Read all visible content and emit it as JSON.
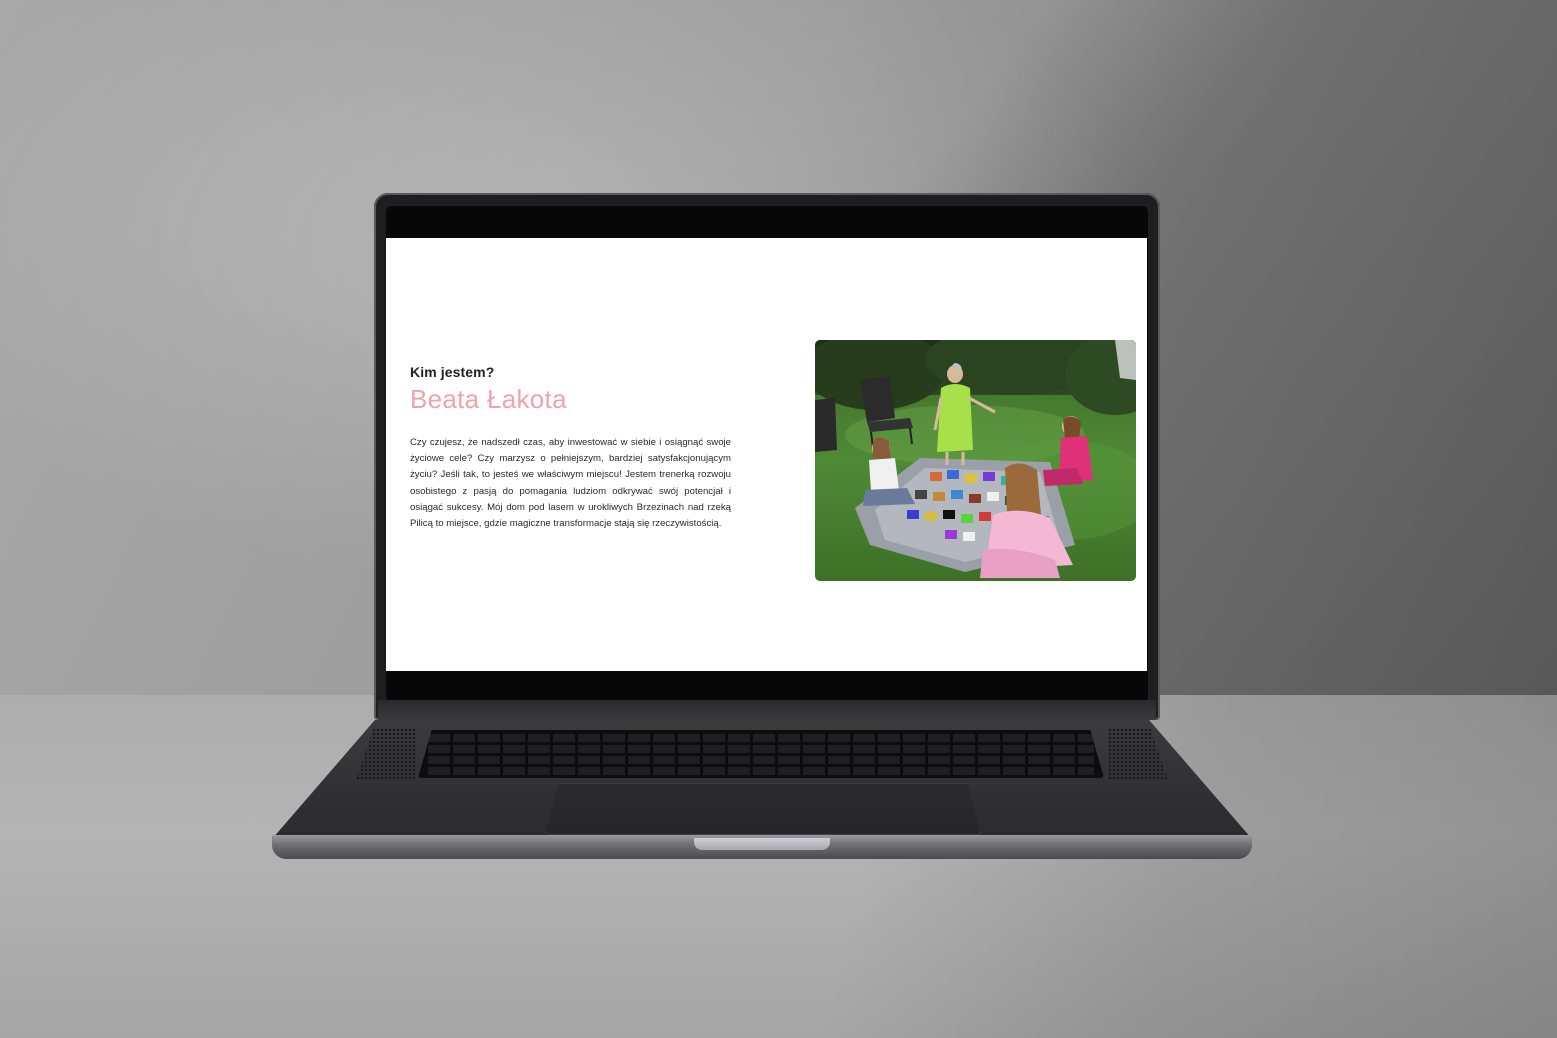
{
  "section": {
    "eyebrow": "Kim jestem?",
    "name": "Beata Łakota",
    "bio": "Czy czujesz, że nadszedł czas, aby inwestować w siebie i osiągnąć swoje życiowe cele? Czy marzysz o pełniejszym, bardziej satysfakcjonującym życiu? Jeśli tak, to jesteś we właściwym miejscu! Jestem trenerką rozwoju osobistego z pasją do pomagania ludziom odkrywać swój potencjał i osiągać sukcesy. Mój dom pod lasem w urokliwych Brzezinach nad rzeką Pilicą to miejsce, gdzie magiczne transformacje stają się rzeczywistością."
  },
  "colors": {
    "accent_pink": "#f0a3ae",
    "text_dark": "#222222",
    "screen_bg": "#ffffff"
  }
}
